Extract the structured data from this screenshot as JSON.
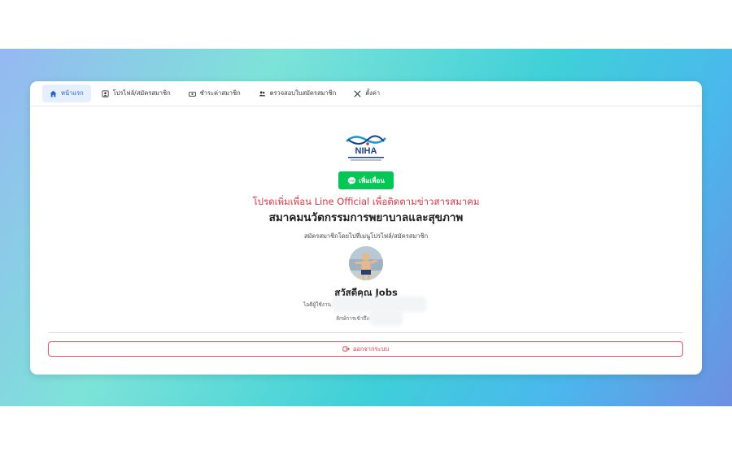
{
  "nav": {
    "tabs": [
      {
        "label": "หน้าแรก",
        "icon": "home-icon",
        "active": true
      },
      {
        "label": "โปรไฟล์/สมัครสมาชิก",
        "icon": "user-card-icon"
      },
      {
        "label": "ชำระค่าสมาชิก",
        "icon": "money-icon"
      },
      {
        "label": "ตรวจสอบใบสมัครสมาชิก",
        "icon": "users-icon"
      },
      {
        "label": "ตั้งค่า",
        "icon": "tools-icon"
      }
    ]
  },
  "logo": {
    "text": "NIHA"
  },
  "line_button": {
    "label": "เพิ่มเพื่อน",
    "color": "#06c755"
  },
  "invite_text": "โปรดเพิ่มเพื่อน Line Official เพื่อติดตามข่าวสารสมาคม",
  "org_name": "สมาคมนวัตกรรมการพยาบาลและสุขภาพ",
  "hint_text": "สมัครสมาชิกโดยไปที่เมนูโปรไฟล์/สมัครสมาชิก",
  "user": {
    "greeting": "สวัสดีคุณ Jobs",
    "username_label": "ไอดีผู้ใช้งาน:",
    "login_method_label": "ลักษ์การเข้าถึง:"
  },
  "logout_label": "ออกจากระบบ",
  "colors": {
    "accent_blue": "#2862c8",
    "danger_red": "#d93745",
    "line_green": "#06c755"
  }
}
